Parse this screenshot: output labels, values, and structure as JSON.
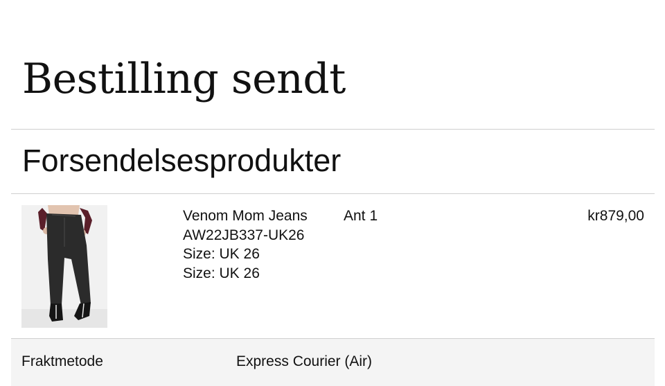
{
  "page": {
    "title": "Bestilling sendt"
  },
  "shipment": {
    "section_title": "Forsendelsesprodukter",
    "items": [
      {
        "image_icon": "jeans-product-photo",
        "name": "Venom Mom Jeans",
        "sku": "AW22JB337-UK26",
        "options": [
          "Size: UK 26",
          "Size: UK 26"
        ],
        "qty_label": "Ant",
        "qty_value": "1",
        "price": "kr879,00"
      }
    ]
  },
  "shipping_method": {
    "label": "Fraktmetode",
    "value": "Express Courier (Air)"
  },
  "colors": {
    "background": "#ffffff",
    "rule": "#cfcfcf",
    "row_background": "#f4f4f4",
    "text": "#111111"
  }
}
